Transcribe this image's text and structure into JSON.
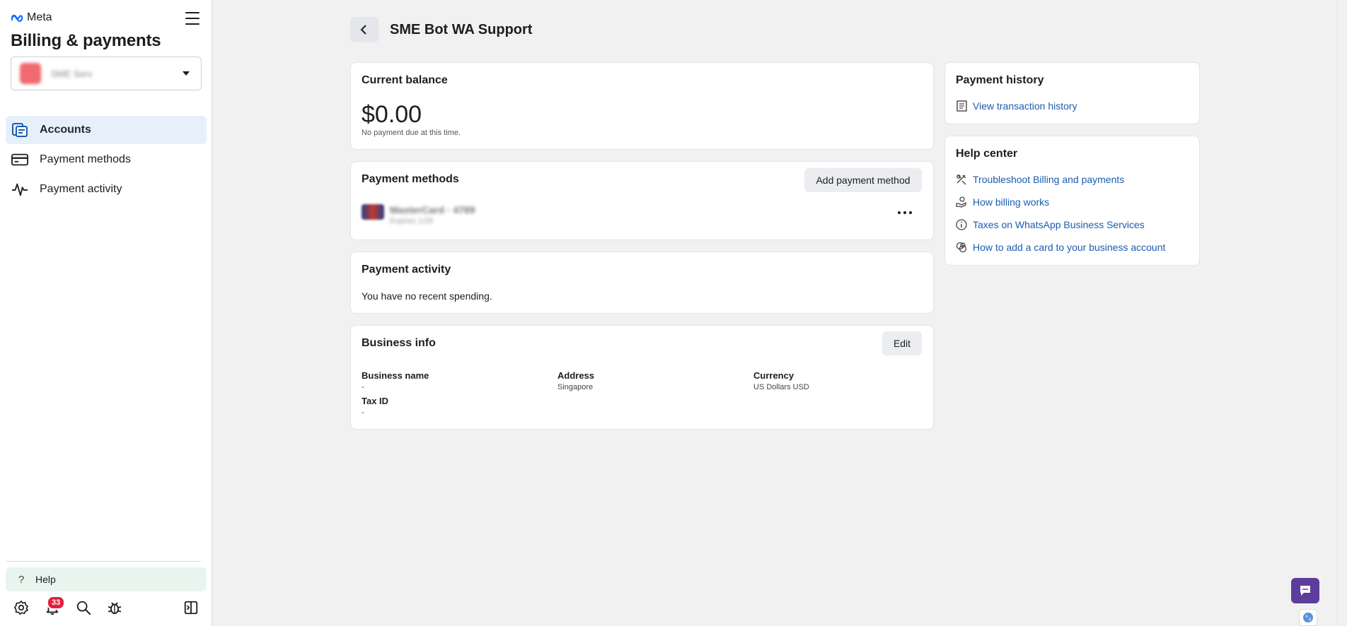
{
  "brand": {
    "name": "Meta",
    "icon": "meta-logo-icon"
  },
  "sidebar": {
    "heading": "Billing & payments",
    "account_selector": {
      "name": "SME Serv",
      "icon": "chevron-down-icon"
    },
    "items": [
      {
        "label": "Accounts",
        "icon": "accounts-icon",
        "active": true
      },
      {
        "label": "Payment methods",
        "icon": "credit-card-icon",
        "active": false
      },
      {
        "label": "Payment activity",
        "icon": "activity-pulse-icon",
        "active": false
      }
    ],
    "help": {
      "label": "Help",
      "icon": "question-icon"
    },
    "bottom": {
      "notification_count": "33",
      "icons": [
        "settings-icon",
        "notification-bell-icon",
        "search-icon",
        "bug-icon",
        "toggle-panel-icon"
      ]
    }
  },
  "header": {
    "title": "SME Bot WA Support",
    "back_icon": "chevron-left-icon"
  },
  "balance": {
    "title": "Current balance",
    "amount": "$0.00",
    "note": "No payment due at this time."
  },
  "payment_methods": {
    "title": "Payment methods",
    "add_label": "Add payment method",
    "card": {
      "name": "MasterCard · 4789",
      "sub": "Expires 1/28"
    }
  },
  "payment_activity": {
    "title": "Payment activity",
    "text": "You have no recent spending."
  },
  "business_info": {
    "title": "Business info",
    "edit_label": "Edit",
    "business_name": {
      "label": "Business name",
      "value": "-"
    },
    "address": {
      "label": "Address",
      "value": "Singapore"
    },
    "currency": {
      "label": "Currency",
      "value": "US Dollars USD"
    },
    "tax_id": {
      "label": "Tax ID",
      "value": "-"
    }
  },
  "payment_history": {
    "title": "Payment history",
    "link": "View transaction history"
  },
  "help_center": {
    "title": "Help center",
    "links": [
      {
        "label": "Troubleshoot Billing and payments",
        "icon": "troubleshoot-icon"
      },
      {
        "label": "How billing works",
        "icon": "billing-hand-icon"
      },
      {
        "label": "Taxes on WhatsApp Business Services",
        "icon": "info-icon"
      },
      {
        "label": "How to add a card to your business account",
        "icon": "card-help-icon"
      }
    ]
  },
  "colors": {
    "link": "#1a5cb0",
    "active_nav": "#e7f0fa",
    "help_bg": "#e8f5ef",
    "chat": "#5c3d9c",
    "badge": "#e41e3f"
  }
}
